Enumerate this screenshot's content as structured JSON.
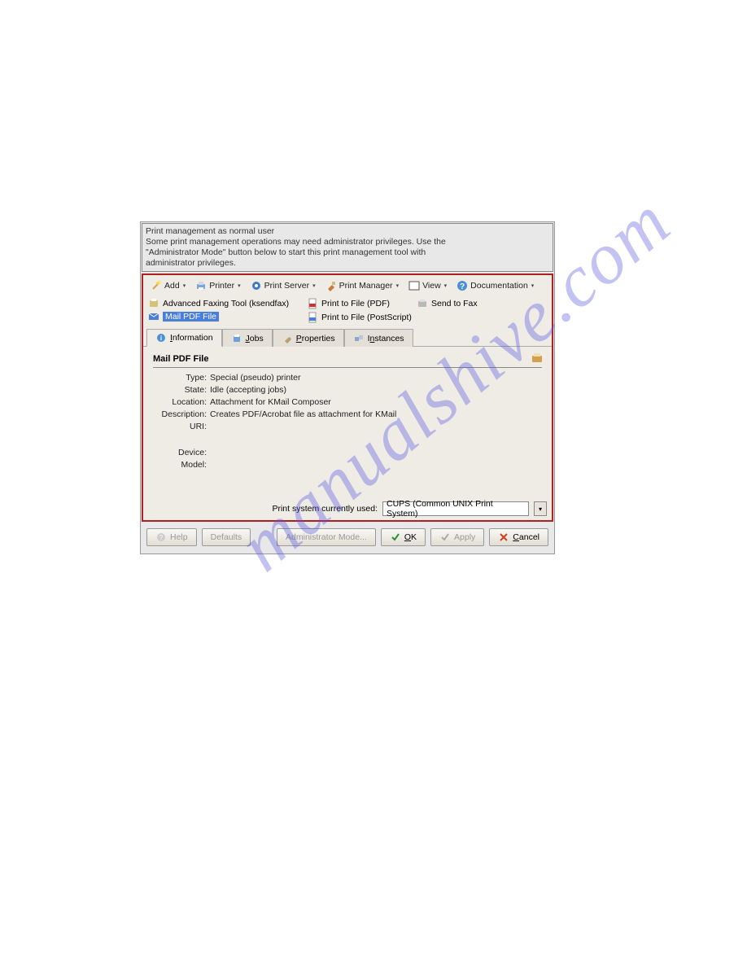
{
  "notice": {
    "line1": "Print management as normal user",
    "line2": "Some print management operations may need administrator privileges. Use the",
    "line3": "\"Administrator Mode\" button below to start this print management tool with",
    "line4": "administrator privileges."
  },
  "toolbar": {
    "add": "Add",
    "printer": "Printer",
    "print_server": "Print Server",
    "print_manager": "Print Manager",
    "view": "View",
    "documentation": "Documentation"
  },
  "printers": {
    "r1c1": "Advanced Faxing Tool (ksendfax)",
    "r1c2": "Print to File (PDF)",
    "r1c3": "Send to Fax",
    "r2c1": "Mail PDF File",
    "r2c2": "Print to File (PostScript)"
  },
  "tabs": {
    "information": "Information",
    "jobs": "Jobs",
    "properties": "Properties",
    "instances": "Instances"
  },
  "info": {
    "title": "Mail PDF File",
    "labels": {
      "type": "Type:",
      "state": "State:",
      "location": "Location:",
      "description": "Description:",
      "uri": "URI:",
      "device": "Device:",
      "model": "Model:"
    },
    "values": {
      "type": "Special (pseudo) printer",
      "state": "Idle (accepting jobs)",
      "location": "Attachment for KMail Composer",
      "description": "Creates PDF/Acrobat file as attachment for KMail",
      "uri": "",
      "device": "",
      "model": ""
    }
  },
  "footer": {
    "label": "Print system currently used:",
    "value": "CUPS (Common UNIX Print System)"
  },
  "buttons": {
    "help": "Help",
    "defaults": "Defaults",
    "admin": "Administrator Mode...",
    "ok": "OK",
    "apply": "Apply",
    "cancel": "Cancel"
  },
  "watermark": "manualshive.com"
}
